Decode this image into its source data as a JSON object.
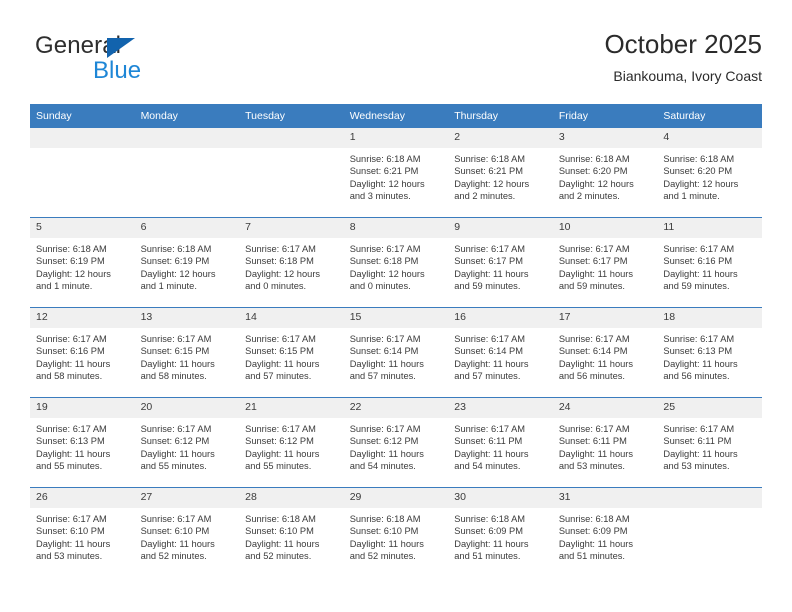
{
  "brand": {
    "word_top": "General",
    "word_bottom": "Blue",
    "triangle_color": "#1263ad",
    "blue_color": "#1e86d6"
  },
  "header": {
    "title": "October 2025",
    "subtitle": "Biankouma, Ivory Coast"
  },
  "theme": {
    "header_blue": "#3a7cbe",
    "daynum_band": "#f0f0f0",
    "text": "#3b3b3b"
  },
  "weekdays": [
    "Sunday",
    "Monday",
    "Tuesday",
    "Wednesday",
    "Thursday",
    "Friday",
    "Saturday"
  ],
  "labels": {
    "sunrise_prefix": "Sunrise:",
    "sunset_prefix": "Sunset:",
    "daylight_prefix": "Daylight:"
  },
  "weeks": [
    [
      {
        "day": "",
        "empty": true
      },
      {
        "day": "",
        "empty": true
      },
      {
        "day": "",
        "empty": true
      },
      {
        "day": "1",
        "sunrise": "Sunrise: 6:18 AM",
        "sunset": "Sunset: 6:21 PM",
        "daylight_line1": "Daylight: 12 hours",
        "daylight_line2": "and 3 minutes."
      },
      {
        "day": "2",
        "sunrise": "Sunrise: 6:18 AM",
        "sunset": "Sunset: 6:21 PM",
        "daylight_line1": "Daylight: 12 hours",
        "daylight_line2": "and 2 minutes."
      },
      {
        "day": "3",
        "sunrise": "Sunrise: 6:18 AM",
        "sunset": "Sunset: 6:20 PM",
        "daylight_line1": "Daylight: 12 hours",
        "daylight_line2": "and 2 minutes."
      },
      {
        "day": "4",
        "sunrise": "Sunrise: 6:18 AM",
        "sunset": "Sunset: 6:20 PM",
        "daylight_line1": "Daylight: 12 hours",
        "daylight_line2": "and 1 minute."
      }
    ],
    [
      {
        "day": "5",
        "sunrise": "Sunrise: 6:18 AM",
        "sunset": "Sunset: 6:19 PM",
        "daylight_line1": "Daylight: 12 hours",
        "daylight_line2": "and 1 minute."
      },
      {
        "day": "6",
        "sunrise": "Sunrise: 6:18 AM",
        "sunset": "Sunset: 6:19 PM",
        "daylight_line1": "Daylight: 12 hours",
        "daylight_line2": "and 1 minute."
      },
      {
        "day": "7",
        "sunrise": "Sunrise: 6:17 AM",
        "sunset": "Sunset: 6:18 PM",
        "daylight_line1": "Daylight: 12 hours",
        "daylight_line2": "and 0 minutes."
      },
      {
        "day": "8",
        "sunrise": "Sunrise: 6:17 AM",
        "sunset": "Sunset: 6:18 PM",
        "daylight_line1": "Daylight: 12 hours",
        "daylight_line2": "and 0 minutes."
      },
      {
        "day": "9",
        "sunrise": "Sunrise: 6:17 AM",
        "sunset": "Sunset: 6:17 PM",
        "daylight_line1": "Daylight: 11 hours",
        "daylight_line2": "and 59 minutes."
      },
      {
        "day": "10",
        "sunrise": "Sunrise: 6:17 AM",
        "sunset": "Sunset: 6:17 PM",
        "daylight_line1": "Daylight: 11 hours",
        "daylight_line2": "and 59 minutes."
      },
      {
        "day": "11",
        "sunrise": "Sunrise: 6:17 AM",
        "sunset": "Sunset: 6:16 PM",
        "daylight_line1": "Daylight: 11 hours",
        "daylight_line2": "and 59 minutes."
      }
    ],
    [
      {
        "day": "12",
        "sunrise": "Sunrise: 6:17 AM",
        "sunset": "Sunset: 6:16 PM",
        "daylight_line1": "Daylight: 11 hours",
        "daylight_line2": "and 58 minutes."
      },
      {
        "day": "13",
        "sunrise": "Sunrise: 6:17 AM",
        "sunset": "Sunset: 6:15 PM",
        "daylight_line1": "Daylight: 11 hours",
        "daylight_line2": "and 58 minutes."
      },
      {
        "day": "14",
        "sunrise": "Sunrise: 6:17 AM",
        "sunset": "Sunset: 6:15 PM",
        "daylight_line1": "Daylight: 11 hours",
        "daylight_line2": "and 57 minutes."
      },
      {
        "day": "15",
        "sunrise": "Sunrise: 6:17 AM",
        "sunset": "Sunset: 6:14 PM",
        "daylight_line1": "Daylight: 11 hours",
        "daylight_line2": "and 57 minutes."
      },
      {
        "day": "16",
        "sunrise": "Sunrise: 6:17 AM",
        "sunset": "Sunset: 6:14 PM",
        "daylight_line1": "Daylight: 11 hours",
        "daylight_line2": "and 57 minutes."
      },
      {
        "day": "17",
        "sunrise": "Sunrise: 6:17 AM",
        "sunset": "Sunset: 6:14 PM",
        "daylight_line1": "Daylight: 11 hours",
        "daylight_line2": "and 56 minutes."
      },
      {
        "day": "18",
        "sunrise": "Sunrise: 6:17 AM",
        "sunset": "Sunset: 6:13 PM",
        "daylight_line1": "Daylight: 11 hours",
        "daylight_line2": "and 56 minutes."
      }
    ],
    [
      {
        "day": "19",
        "sunrise": "Sunrise: 6:17 AM",
        "sunset": "Sunset: 6:13 PM",
        "daylight_line1": "Daylight: 11 hours",
        "daylight_line2": "and 55 minutes."
      },
      {
        "day": "20",
        "sunrise": "Sunrise: 6:17 AM",
        "sunset": "Sunset: 6:12 PM",
        "daylight_line1": "Daylight: 11 hours",
        "daylight_line2": "and 55 minutes."
      },
      {
        "day": "21",
        "sunrise": "Sunrise: 6:17 AM",
        "sunset": "Sunset: 6:12 PM",
        "daylight_line1": "Daylight: 11 hours",
        "daylight_line2": "and 55 minutes."
      },
      {
        "day": "22",
        "sunrise": "Sunrise: 6:17 AM",
        "sunset": "Sunset: 6:12 PM",
        "daylight_line1": "Daylight: 11 hours",
        "daylight_line2": "and 54 minutes."
      },
      {
        "day": "23",
        "sunrise": "Sunrise: 6:17 AM",
        "sunset": "Sunset: 6:11 PM",
        "daylight_line1": "Daylight: 11 hours",
        "daylight_line2": "and 54 minutes."
      },
      {
        "day": "24",
        "sunrise": "Sunrise: 6:17 AM",
        "sunset": "Sunset: 6:11 PM",
        "daylight_line1": "Daylight: 11 hours",
        "daylight_line2": "and 53 minutes."
      },
      {
        "day": "25",
        "sunrise": "Sunrise: 6:17 AM",
        "sunset": "Sunset: 6:11 PM",
        "daylight_line1": "Daylight: 11 hours",
        "daylight_line2": "and 53 minutes."
      }
    ],
    [
      {
        "day": "26",
        "sunrise": "Sunrise: 6:17 AM",
        "sunset": "Sunset: 6:10 PM",
        "daylight_line1": "Daylight: 11 hours",
        "daylight_line2": "and 53 minutes."
      },
      {
        "day": "27",
        "sunrise": "Sunrise: 6:17 AM",
        "sunset": "Sunset: 6:10 PM",
        "daylight_line1": "Daylight: 11 hours",
        "daylight_line2": "and 52 minutes."
      },
      {
        "day": "28",
        "sunrise": "Sunrise: 6:18 AM",
        "sunset": "Sunset: 6:10 PM",
        "daylight_line1": "Daylight: 11 hours",
        "daylight_line2": "and 52 minutes."
      },
      {
        "day": "29",
        "sunrise": "Sunrise: 6:18 AM",
        "sunset": "Sunset: 6:10 PM",
        "daylight_line1": "Daylight: 11 hours",
        "daylight_line2": "and 52 minutes."
      },
      {
        "day": "30",
        "sunrise": "Sunrise: 6:18 AM",
        "sunset": "Sunset: 6:09 PM",
        "daylight_line1": "Daylight: 11 hours",
        "daylight_line2": "and 51 minutes."
      },
      {
        "day": "31",
        "sunrise": "Sunrise: 6:18 AM",
        "sunset": "Sunset: 6:09 PM",
        "daylight_line1": "Daylight: 11 hours",
        "daylight_line2": "and 51 minutes."
      },
      {
        "day": "",
        "empty": true
      }
    ]
  ]
}
